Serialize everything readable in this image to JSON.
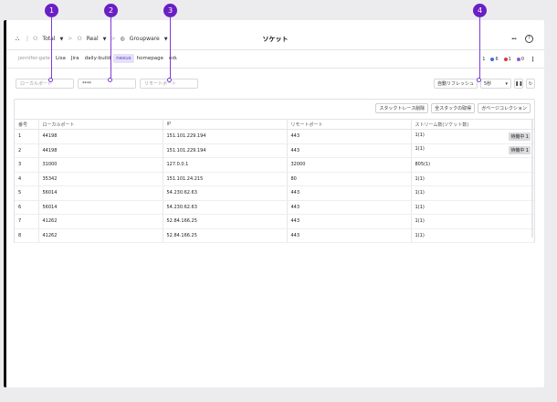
{
  "window": {
    "title": "ソケット"
  },
  "breadcrumb": {
    "item1": "Total",
    "item2": "Real",
    "item3": "Groupware"
  },
  "tabs": [
    {
      "label": "jennifer-gate",
      "state": "muted"
    },
    {
      "label": "Lisa",
      "state": "normal"
    },
    {
      "label": "Jira",
      "state": "normal"
    },
    {
      "label": "daily-build",
      "state": "normal"
    },
    {
      "label": "nexus",
      "state": "active"
    },
    {
      "label": "homepage",
      "state": "normal"
    },
    {
      "label": "edu",
      "state": "cut"
    }
  ],
  "tab_status": {
    "count": "1",
    "blue": "6",
    "red": "1",
    "purple": "0",
    "colors": {
      "blue": "#3b6fd8",
      "red": "#d83b3b",
      "purple": "#8a5bd8"
    }
  },
  "filters": {
    "local_port_placeholder": "ローカルポート",
    "masked_value": "****",
    "remote_port_placeholder": "リモートポート"
  },
  "refresh": {
    "label": "自動リフレッシュ",
    "interval": "5秒",
    "pause_icon": "pause-icon",
    "reload_icon": "reload-icon"
  },
  "actions": {
    "stack_delete": "スタックトレース削除",
    "all_stacks": "全スタックの取得",
    "gc": "ガベージコレクション"
  },
  "table": {
    "headers": {
      "num": "番号",
      "local_port": "ローカルポート",
      "ip": "IP",
      "remote_port": "リモートポート",
      "streams": "ストリーム数(ソケット数)"
    },
    "rows": [
      {
        "num": "1",
        "local_port": "44198",
        "ip": "151.101.229.194",
        "remote_port": "443",
        "streams": "1(1)",
        "badge": "待機中 1"
      },
      {
        "num": "2",
        "local_port": "44198",
        "ip": "151.101.229.194",
        "remote_port": "443",
        "streams": "1(1)",
        "badge": "待機中 1"
      },
      {
        "num": "3",
        "local_port": "31000",
        "ip": "127.0.0.1",
        "remote_port": "32000",
        "streams": "805(1)",
        "badge": ""
      },
      {
        "num": "4",
        "local_port": "35342",
        "ip": "151.101.24.215",
        "remote_port": "80",
        "streams": "1(1)",
        "badge": ""
      },
      {
        "num": "5",
        "local_port": "56014",
        "ip": "54.230.62.63",
        "remote_port": "443",
        "streams": "1(1)",
        "badge": ""
      },
      {
        "num": "6",
        "local_port": "56014",
        "ip": "54.230.62.63",
        "remote_port": "443",
        "streams": "1(1)",
        "badge": ""
      },
      {
        "num": "7",
        "local_port": "41262",
        "ip": "52.84.166.25",
        "remote_port": "443",
        "streams": "1(1)",
        "badge": ""
      },
      {
        "num": "8",
        "local_port": "41262",
        "ip": "52.84.166.25",
        "remote_port": "443",
        "streams": "1(1)",
        "badge": ""
      }
    ]
  },
  "markers": [
    "1",
    "2",
    "3",
    "4"
  ],
  "marker_color": "#6a1fc4"
}
